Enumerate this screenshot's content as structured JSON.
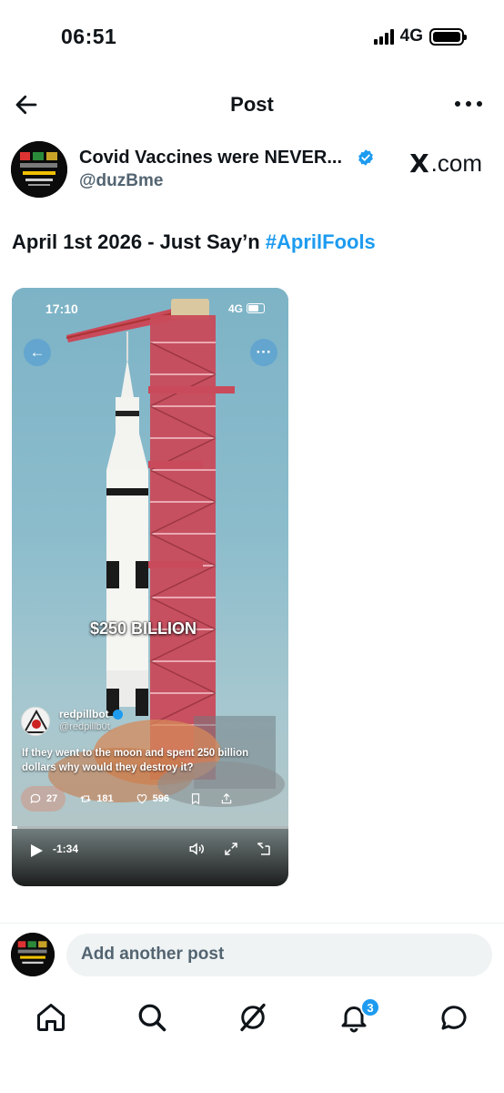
{
  "status_bar": {
    "time": "06:51",
    "network": "4G"
  },
  "header": {
    "title": "Post"
  },
  "author": {
    "name": "Covid Vaccines were NEVER...",
    "handle": "@duzBme",
    "source_text": ".com",
    "source_logo": "X"
  },
  "tweet": {
    "text": "April 1st 2026 - Just Say’n ",
    "hashtag": "#AprilFools"
  },
  "media": {
    "status_time": "17:10",
    "status_network": "4G",
    "overlay_text": "$250 BILLION",
    "embed_author_name": "redpillbot",
    "embed_author_handle": "@redpillb0t",
    "embed_text": "If they went to the moon and spent 250 billion dollars why would they destroy it?",
    "replies": "27",
    "reposts": "181",
    "likes": "596",
    "time_remaining": "-1:34",
    "progress": 0.02
  },
  "composer": {
    "placeholder": "Add another post"
  },
  "tabbar": {
    "notifications_badge": "3"
  },
  "colors": {
    "accent": "#1d9bf0",
    "secondary_text": "#536471",
    "tower_red": "#c94a5a"
  }
}
